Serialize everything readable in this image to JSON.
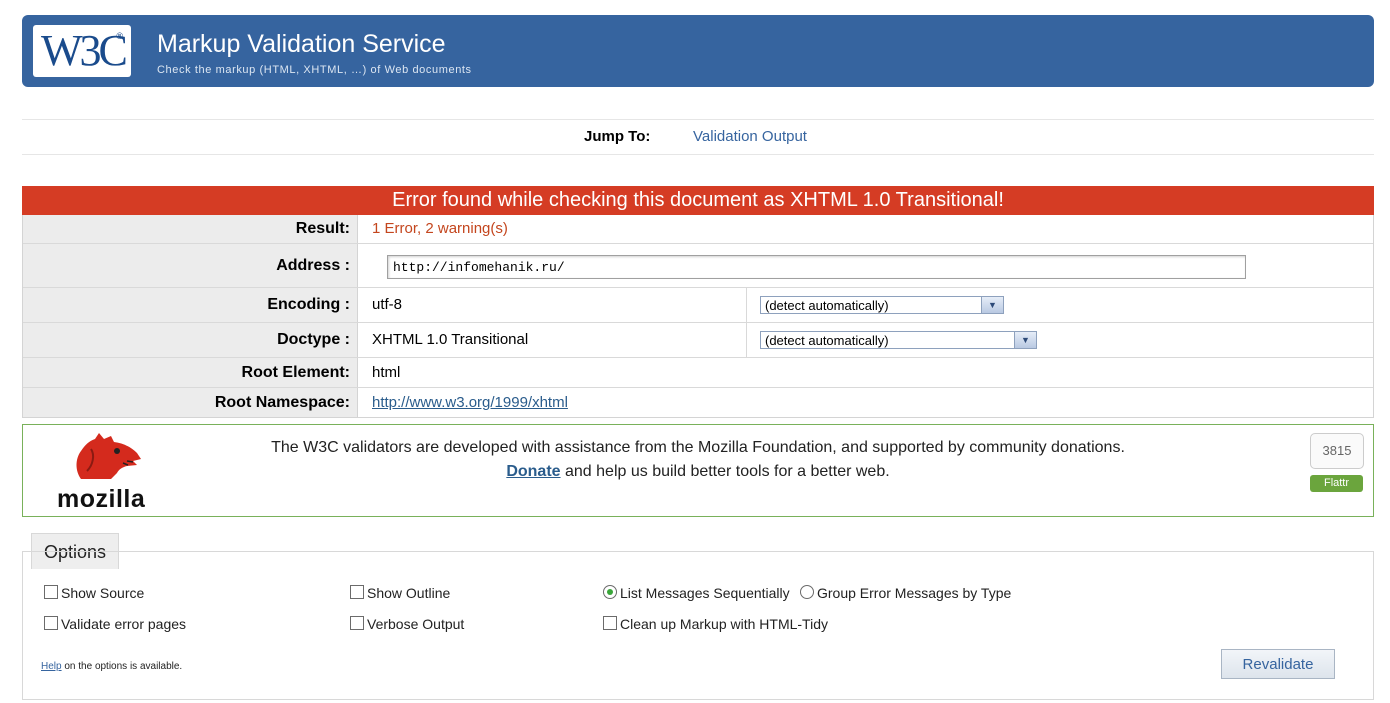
{
  "banner": {
    "logo": "W3C",
    "logo_reg": "®",
    "title": "Markup Validation Service",
    "subtitle": "Check the markup (HTML, XHTML, …) of Web documents"
  },
  "jump": {
    "label": "Jump To:",
    "link": "Validation Output"
  },
  "error_header": "Error found while checking this document as XHTML 1.0 Transitional!",
  "result_rows": {
    "result": {
      "label": "Result:",
      "value": "1 Error, 2 warning(s)"
    },
    "address": {
      "label": "Address :",
      "value": "http://infomehanik.ru/"
    },
    "encoding": {
      "label": "Encoding :",
      "value": "utf-8",
      "select": "(detect automatically)"
    },
    "doctype": {
      "label": "Doctype :",
      "value": "XHTML 1.0 Transitional",
      "select": "(detect automatically)"
    },
    "root_element": {
      "label": "Root Element:",
      "value": "html"
    },
    "root_namespace": {
      "label": "Root Namespace:",
      "value": "http://www.w3.org/1999/xhtml"
    }
  },
  "mozilla": {
    "logo_text": "mozilla",
    "line1": "The W3C validators are developed with assistance from the Mozilla Foundation, and supported by community donations.",
    "donate": "Donate",
    "line2_rest": " and help us build better tools for a better web.",
    "flattr_count": "3815",
    "flattr_label": "Flattr"
  },
  "options": {
    "legend": "Options",
    "show_source": "Show Source",
    "show_outline": "Show Outline",
    "list_sequential": "List Messages Sequentially",
    "group_by_type": "Group Error Messages by Type",
    "validate_error_pages": "Validate error pages",
    "verbose_output": "Verbose Output",
    "html_tidy": "Clean up Markup with HTML-Tidy",
    "help_link": "Help",
    "help_rest": " on the options is available.",
    "revalidate": "Revalidate"
  },
  "colors": {
    "banner": "#36649f",
    "error": "#d53c24",
    "result_text": "#c4461e",
    "mozilla_border": "#79b15a",
    "mozilla_red": "#d42a1d"
  }
}
